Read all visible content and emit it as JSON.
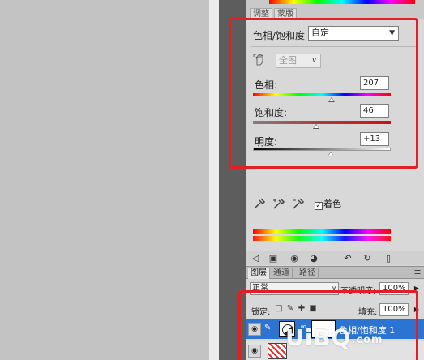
{
  "app": {
    "accent_color": "#2b74d1",
    "highlight_color": "#e11f26"
  },
  "adjustments_panel": {
    "tabs": [
      "调整",
      "蒙版"
    ],
    "preset_label": "色相/饱和度",
    "preset_value": "自定",
    "channel_value": "全图",
    "icons": [
      "hand-target-icon"
    ],
    "sliders": [
      {
        "label": "色相:",
        "value": "207",
        "position_fraction": 0.56
      },
      {
        "label": "饱和度:",
        "value": "46",
        "position_fraction": 0.46
      },
      {
        "label": "明度:",
        "value": "+13",
        "position_fraction": 0.56
      }
    ],
    "colorize_label": "着色",
    "colorize_checked": true
  },
  "layers_panel": {
    "tabs": [
      "图层",
      "通道",
      "路径"
    ],
    "blend_mode": "正常",
    "opacity_label": "不透明度:",
    "opacity_value": "100%",
    "lock_label": "锁定:",
    "fill_label": "填充:",
    "fill_value": "100%",
    "layers": [
      {
        "name": "色相/饱和度 1",
        "selected": true
      }
    ]
  },
  "watermark": {
    "text": "UiBQ",
    "suffix": ".com"
  }
}
